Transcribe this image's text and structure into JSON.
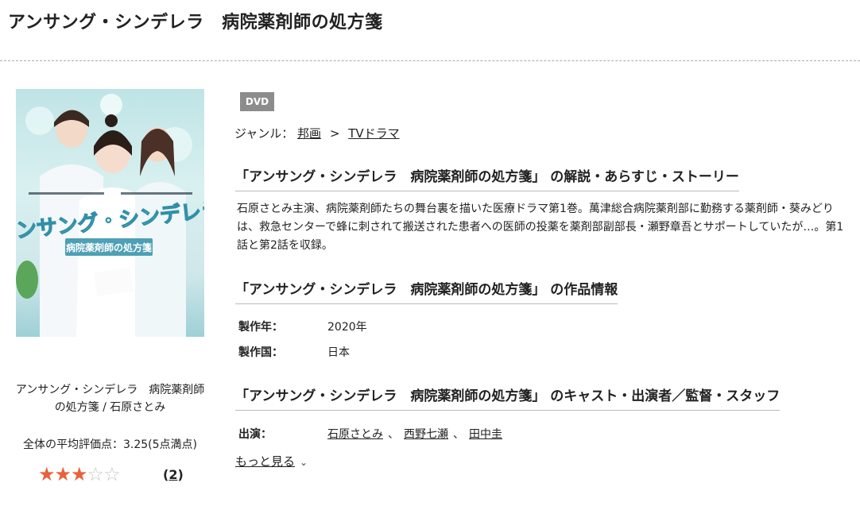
{
  "page": {
    "title": "アンサング・シンデレラ　病院薬剤師の処方箋"
  },
  "poster": {
    "logo_main": "アンサング・シンデレラ",
    "logo_sub": "病院薬剤師の処方箋"
  },
  "sidebar": {
    "caption": "アンサング・シンデレラ　病院薬剤師の処方箋 / 石原さとみ",
    "rating_text": "全体の平均評価点：3.25(5点満点)",
    "rating_value": 3.25,
    "rating_max": 5,
    "stars": {
      "full": "★★★",
      "empty": "☆☆"
    },
    "review_count": "2",
    "review_open": "(",
    "review_close": ")"
  },
  "badge": {
    "label": "DVD"
  },
  "genre": {
    "label": "ジャンル：",
    "items": [
      "邦画",
      "TVドラマ"
    ],
    "separator": ">"
  },
  "sections": {
    "story_heading": "「アンサング・シンデレラ　病院薬剤師の処方箋」 の解説・あらすじ・ストーリー",
    "story_text": "石原さとみ主演、病院薬剤師たちの舞台裏を描いた医療ドラマ第1巻。萬津総合病院薬剤部に勤務する薬剤師・葵みどりは、救急センターで蜂に刺されて搬送された患者への医師の投薬を薬剤部副部長・瀬野章吾とサポートしていたが…。第1話と第2話を収録。",
    "info_heading": "「アンサング・シンデレラ　病院薬剤師の処方箋」 の作品情報",
    "year_label": "製作年：",
    "year_value": "2020年",
    "country_label": "製作国：",
    "country_value": "日本",
    "cast_heading": "「アンサング・シンデレラ　病院薬剤師の処方箋」 のキャスト・出演者／監督・スタッフ",
    "cast_label": "出演：",
    "cast": [
      "石原さとみ",
      "西野七瀬",
      "田中圭"
    ],
    "cast_separator": "、",
    "more_label": "もっと見る"
  }
}
